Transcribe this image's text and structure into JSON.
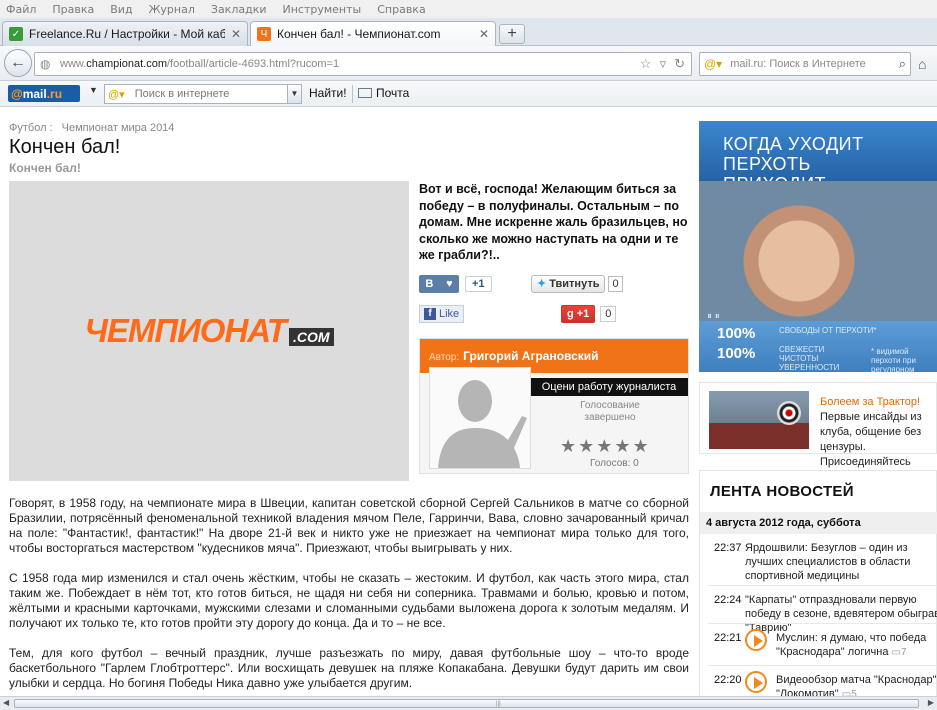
{
  "menu": [
    "Файл",
    "Правка",
    "Вид",
    "Журнал",
    "Закладки",
    "Инструменты",
    "Справка"
  ],
  "tabs": [
    {
      "title": "Freelance.Ru / Настройки - Мой кабинет"
    },
    {
      "title": "Кончен бал! - Чемпионат.com"
    }
  ],
  "nav": {
    "url_plain": "www.",
    "url_domain": "championat.com",
    "url_rest": "/football/article-4693.html?rucom=1",
    "search_placeholder": "mail.ru: Поиск в Интернете"
  },
  "mailru_toolbar": {
    "logo_at": "@",
    "logo_mail": "mail",
    "logo_ru": ".ru",
    "search_placeholder": "Поиск в интернете",
    "find_label": "Найти!",
    "mail_label": "Почта"
  },
  "article": {
    "crumb_section": "Футбол :",
    "crumb_tag": "Чемпионат мира 2014",
    "title": "Кончен бал!",
    "subtitle": "Кончен бал!",
    "logo_word": "ЧЕМПИОНАТ",
    "logo_com": ".COM",
    "lead": "Вот и всё, господа! Желающим биться за победу – в полуфиналы. Остальным – по домам. Мне искренне жаль бразильцев, но сколько же можно наступать на одни и те же грабли?!..",
    "social": {
      "vk_letter": "В",
      "vk_count": "+1",
      "tweet_label": "Твитнуть",
      "tweet_count": "0",
      "fb_label": "Like",
      "gplus_label": "+1",
      "gplus_count": "0"
    },
    "author": {
      "prefix": "Автор:",
      "name": "Григорий Аграновский",
      "rate_label": "Оцени работу журналиста",
      "vote_status_1": "Голосование",
      "vote_status_2": "завершено",
      "stars": "★★★★★",
      "votes": "Голосов: 0"
    },
    "paragraphs": [
      "Говорят, в 1958 году, на чемпионате мира в Швеции, капитан советской сборной Сергей Сальников в матче со сборной Бразилии, потрясённый феноменальной техникой владения мячом Пеле, Гарринчи, Вава, словно зачарованный кричал на поле: \"Фантастик!, фантастик!\" На дворе 21-й век и никто уже не приезжает на чемпионат мира только для того, чтобы восторгаться мастерством \"кудесников мяча\". Приезжают, чтобы выигрывать у них.",
      "С 1958 года мир изменился и стал очень жёстким, чтобы не сказать – жестоким. И футбол, как часть этого мира, стал таким же. Побеждает в нём тот, кто готов биться, не щадя ни себя ни соперника. Травмами и болью, кровью и потом, жёлтыми и красными карточками, мужскими слезами и сломанными судьбами выложена дорога к золотым медалям. И получают их только те, кто готов пройти эту дорогу до конца. Да и то – не все.",
      "Тем, для кого футбол – вечный праздник, лучше разъезжать по миру, давая футбольные шоу – что-то вроде баскетбольного \"Гарлем Глобтроттерс\". Или восхищать девушек на пляже Копакабана. Девушки будут дарить им свои улыбки и сердца. Но богиня Победы Ника давно уже улыбается другим."
    ]
  },
  "ad": {
    "line1": "КОГДА УХОДИТ ПЕРХОТЬ",
    "line2": "ПРИХОДИТ УВЕРЕННОСТЬ",
    "pct1": "100%",
    "tag1": "СВОБОДЫ ОТ ПЕРХОТИ*",
    "pct2": "100%",
    "tag2": "СВЕЖЕСТИ ЧИСТОТЫ УВЕРЕННОСТИ",
    "note": "* видимой перхоти при регулярном применении"
  },
  "promo": {
    "link": "Болеем за Трактор!",
    "text": " Первые инсайды из клуба, общение без цензуры. Присоединяйтесь"
  },
  "news": {
    "title": "ЛЕНТА НОВОСТЕЙ",
    "date": "4 августа 2012 года, суббота",
    "items": [
      {
        "time": "22:37",
        "text": "Ярдошвили: Безуглов – один из лучших специалистов в области спортивной медицины",
        "comments": ""
      },
      {
        "time": "22:24",
        "text": "\"Карпаты\" отпраздновали первую победу в сезоне, вдевятером обыграв \"Таврию\"",
        "comments": ""
      },
      {
        "time": "22:21",
        "text": "Муслин: я думаю, что победа \"Краснодара\" логична",
        "comments": "7"
      },
      {
        "time": "22:20",
        "text": "Видеообзор матча \"Краснодар\" – \"Локомотив\"",
        "comments": "5"
      }
    ]
  }
}
